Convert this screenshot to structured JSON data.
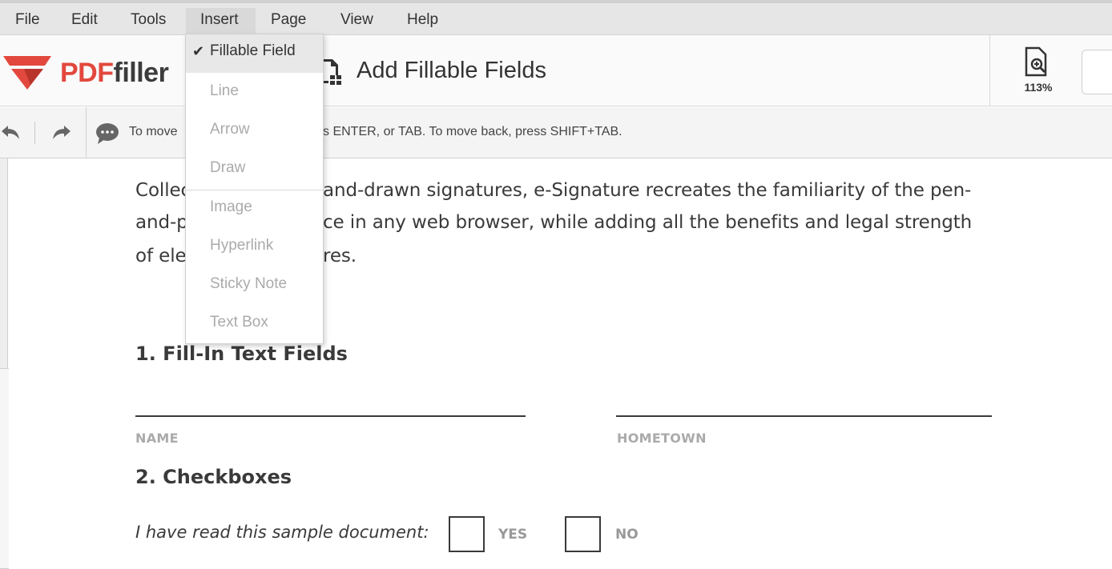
{
  "menubar": {
    "items": [
      {
        "label": "File"
      },
      {
        "label": "Edit"
      },
      {
        "label": "Tools"
      },
      {
        "label": "Insert"
      },
      {
        "label": "Page"
      },
      {
        "label": "View"
      },
      {
        "label": "Help"
      }
    ],
    "active": "Insert"
  },
  "header": {
    "logo_pdf": "PDF",
    "logo_filler": "filler",
    "tool_title": "Add Fillable Fields",
    "zoom_label": "113%",
    "icons": {
      "zoom": "zoom-page-icon",
      "tool": "fillable-fields-icon"
    }
  },
  "toolbar": {
    "hint_left": "To move",
    "hint_right": "s ENTER, or TAB. To move back, press SHIFT+TAB.",
    "icons": {
      "undo": "undo-icon",
      "redo": "redo-icon",
      "hint": "speech-bubble-icon"
    }
  },
  "insert_menu": {
    "items": [
      {
        "label": "Fillable Field",
        "checked": true
      },
      {
        "label": "Line"
      },
      {
        "label": "Arrow"
      },
      {
        "label": "Draw"
      },
      {
        "label": "Image"
      },
      {
        "label": "Hyperlink"
      },
      {
        "label": "Sticky Note"
      },
      {
        "label": "Text Box"
      }
    ]
  },
  "document": {
    "paragraph": [
      {
        "left": "Collec",
        "right": "and-drawn signatures, e-Signature recreates the familiarity of the pen-"
      },
      {
        "left": "and-p",
        "right": "ce in any web browser, while adding all the benefits and legal strength"
      },
      {
        "left": "of ele",
        "right": "res."
      }
    ],
    "section1_title": "1. Fill-In Text Fields",
    "name_label": "NAME",
    "hometown_label": "HOMETOWN",
    "section2_title": "2. Checkboxes",
    "checkbox_prompt": "I have read this sample document:",
    "yes_label": "YES",
    "no_label": "NO"
  },
  "colors": {
    "brand_red": "#e2483d",
    "text_dark": "#3a3a3a",
    "menubar_bg": "#e6e6e6"
  }
}
